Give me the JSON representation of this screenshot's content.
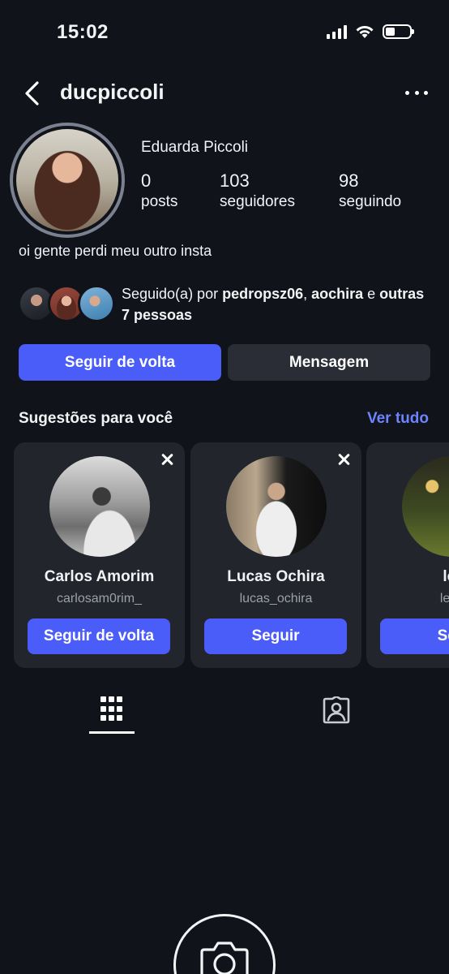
{
  "status_bar": {
    "time": "15:02",
    "icons": [
      "signal-icon",
      "wifi-icon",
      "battery-icon"
    ]
  },
  "header": {
    "username": "ducpiccoli",
    "back_icon": "chevron-left-icon",
    "more_icon": "more-horizontal-icon"
  },
  "profile": {
    "full_name": "Eduarda Piccoli",
    "stats": [
      {
        "value": "0",
        "label": "posts"
      },
      {
        "value": "103",
        "label": "seguidores"
      },
      {
        "value": "98",
        "label": "seguindo"
      }
    ],
    "bio": "oi gente perdi meu outro insta"
  },
  "followed_by": {
    "prefix": "Seguido(a) por ",
    "user1": "pedropsz06",
    "separator": ", ",
    "user2": "aochira",
    "connector": " e ",
    "others": "outras 7 pessoas"
  },
  "actions": {
    "follow_back": "Seguir de volta",
    "message": "Mensagem"
  },
  "suggestions": {
    "title": "Sugestões para você",
    "see_all": "Ver tudo",
    "cards": [
      {
        "name": "Carlos Amorim",
        "handle": "carlosam0rim_",
        "button": "Seguir de volta"
      },
      {
        "name": "Lucas Ochira",
        "handle": "lucas_ochira",
        "button": "Seguir"
      },
      {
        "name": "let",
        "handle": "legc",
        "button": "Seg"
      }
    ]
  },
  "tabs": {
    "grid_icon": "grid-icon",
    "tagged_icon": "tagged-person-icon"
  },
  "empty_state": {
    "icon": "camera-icon"
  },
  "colors": {
    "background": "#10131a",
    "primary": "#4a5df9",
    "secondary": "#2a2d35",
    "card": "#22252c",
    "link": "#6e84ff"
  }
}
